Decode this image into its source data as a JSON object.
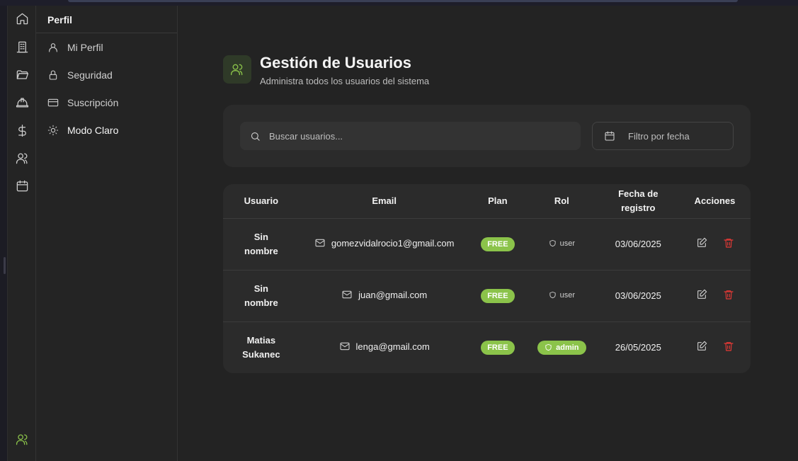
{
  "nav_rail": {
    "icons": [
      "home-icon",
      "building-icon",
      "folder-icon",
      "hard-hat-icon",
      "dollar-icon",
      "users-icon",
      "calendar-icon"
    ],
    "bottom_icon": "users-icon",
    "accent_color": "#8bc34a"
  },
  "profile_panel": {
    "title": "Perfil",
    "items": [
      {
        "label": "Mi Perfil",
        "icon": "user-icon"
      },
      {
        "label": "Seguridad",
        "icon": "lock-icon"
      },
      {
        "label": "Suscripción",
        "icon": "credit-card-icon"
      },
      {
        "label": "Modo Claro",
        "icon": "sun-icon"
      }
    ]
  },
  "header": {
    "title": "Gestión de Usuarios",
    "subtitle": "Administra todos los usuarios del sistema",
    "icon": "users-icon"
  },
  "filters": {
    "search_placeholder": "Buscar usuarios...",
    "date_label": "Filtro por fecha"
  },
  "table": {
    "columns": [
      "Usuario",
      "Email",
      "Plan",
      "Rol",
      "Fecha de registro",
      "Acciones"
    ],
    "rows": [
      {
        "user": "Sin nombre",
        "email": "gomezvidalrocio1@gmail.com",
        "plan": "FREE",
        "role": "user",
        "date": "03/06/2025"
      },
      {
        "user": "Sin nombre",
        "email": "juan@gmail.com",
        "plan": "FREE",
        "role": "user",
        "date": "03/06/2025"
      },
      {
        "user": "Matias Sukanec",
        "email": "lenga@gmail.com",
        "plan": "FREE",
        "role": "admin",
        "date": "26/05/2025"
      }
    ]
  },
  "colors": {
    "accent": "#8bc34a",
    "delete": "#e53935",
    "background": "#232323",
    "card": "#2b2b2b"
  }
}
